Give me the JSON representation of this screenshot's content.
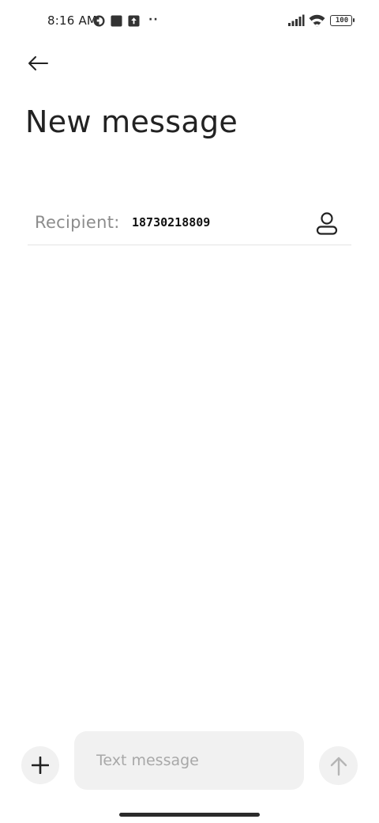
{
  "status_bar": {
    "time": "8:16 AM",
    "dots": "··",
    "battery": "100"
  },
  "header": {
    "back_icon": "arrow-left-icon",
    "title": "New message"
  },
  "recipient": {
    "label": "Recipient:",
    "value": "18730218809",
    "contact_icon": "person-icon"
  },
  "composer": {
    "add_icon": "plus-icon",
    "placeholder": "Text message",
    "value": "",
    "send_icon": "arrow-up-icon"
  },
  "colors": {
    "text_primary": "#222222",
    "label_gray": "#8c8c8c",
    "placeholder_gray": "#a8a8a8",
    "surface_gray": "#f1f1f1",
    "divider": "#e4e4e4"
  }
}
